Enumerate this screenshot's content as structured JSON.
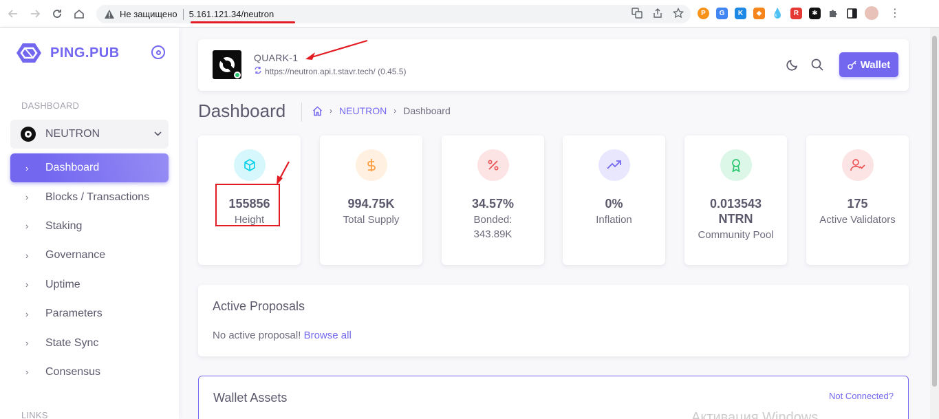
{
  "browser": {
    "security_label": "Не защищено",
    "url": "5.161.121.34/neutron"
  },
  "sidebar": {
    "brand_name": "PING.PUB",
    "section_dashboard": "DASHBOARD",
    "chain_name": "NEUTRON",
    "items": [
      {
        "label": "Dashboard"
      },
      {
        "label": "Blocks / Transactions"
      },
      {
        "label": "Staking"
      },
      {
        "label": "Governance"
      },
      {
        "label": "Uptime"
      },
      {
        "label": "Parameters"
      },
      {
        "label": "State Sync"
      },
      {
        "label": "Consensus"
      }
    ],
    "section_links": "LINKS"
  },
  "navbar": {
    "chain_id": "QUARK-1",
    "endpoint": "https://neutron.api.t.stavr.tech/ (0.45.5)",
    "wallet_label": "Wallet"
  },
  "page": {
    "title": "Dashboard",
    "breadcrumb": {
      "chain": "NEUTRON",
      "current": "Dashboard"
    }
  },
  "stats": [
    {
      "icon": "cube-icon",
      "value": "155856",
      "label": "Height",
      "color": "#00cfe8"
    },
    {
      "icon": "dollar-icon",
      "value": "994.75K",
      "label": "Total Supply",
      "color": "#ff9f43"
    },
    {
      "icon": "percent-icon",
      "value": "34.57%",
      "label": "Bonded: 343.89K",
      "color": "#ea5455"
    },
    {
      "icon": "trending-up-icon",
      "value": "0%",
      "label": "Inflation",
      "color": "#7367f0"
    },
    {
      "icon": "award-icon",
      "value": "0.013543 NTRN",
      "label": "Community Pool",
      "color": "#28c76f"
    },
    {
      "icon": "user-check-icon",
      "value": "175",
      "label": "Active Validators",
      "color": "#ea5455"
    }
  ],
  "proposals": {
    "title": "Active Proposals",
    "empty_text": "No active proposal!",
    "browse_link": "Browse all"
  },
  "wallet_assets": {
    "title": "Wallet Assets",
    "status": "Not Connected?"
  },
  "watermark": "Активация Windows"
}
